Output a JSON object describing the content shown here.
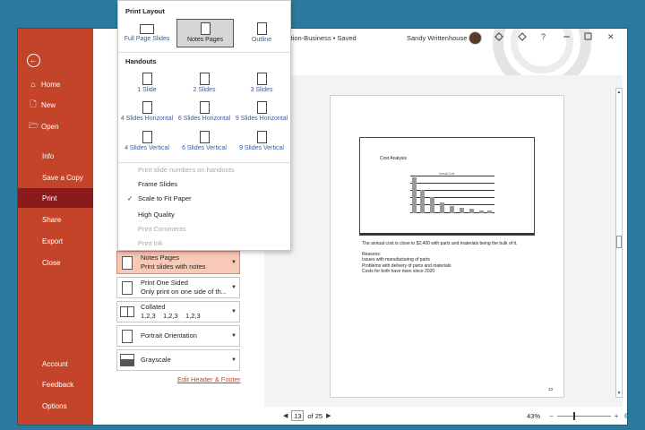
{
  "titlebar": {
    "doc_title": "entation-Business • Saved",
    "user": "Sandy Writtenhouse",
    "icons": [
      "share-icon",
      "diamond-icon",
      "help-icon",
      "minimize-icon",
      "restore-icon",
      "close-icon"
    ],
    "help_glyph": "?",
    "close_glyph": "✕"
  },
  "nav": {
    "back_glyph": "←",
    "items": [
      {
        "label": "Home",
        "icon": "home-icon",
        "glyph": "⌂"
      },
      {
        "label": "New",
        "icon": "new-icon",
        "glyph": "🗋"
      },
      {
        "label": "Open",
        "icon": "open-folder-icon",
        "glyph": "🗁"
      },
      {
        "label": "Info"
      },
      {
        "label": "Save a Copy"
      },
      {
        "label": "Print",
        "active": true
      },
      {
        "label": "Share"
      },
      {
        "label": "Export"
      },
      {
        "label": "Close"
      },
      {
        "label": "Account"
      },
      {
        "label": "Feedback"
      },
      {
        "label": "Options"
      }
    ]
  },
  "dropdown": {
    "print_layout_heading": "Print Layout",
    "layouts": [
      "Full Page Slides",
      "Notes Pages",
      "Outline"
    ],
    "selected_layout": "Notes Pages",
    "handouts_heading": "Handouts",
    "handouts": [
      "1 Slide",
      "2 Slides",
      "3 Slides",
      "4 Slides Horizontal",
      "6 Slides Horizontal",
      "9 Slides Horizontal",
      "4 Slides Vertical",
      "6 Slides Vertical",
      "9 Slides Vertical"
    ],
    "options": [
      {
        "label": "Print slide numbers on handouts",
        "enabled": false
      },
      {
        "label": "Frame Slides",
        "enabled": true
      },
      {
        "label": "Scale to Fit Paper",
        "enabled": true,
        "checked": true
      },
      {
        "label": "High Quality",
        "enabled": true
      },
      {
        "label": "Print Comments",
        "enabled": false
      },
      {
        "label": "Print Ink",
        "enabled": false
      }
    ],
    "check_glyph": "✓"
  },
  "settings": {
    "layout": {
      "title": "Notes Pages",
      "sub": "Print slides with notes"
    },
    "sides": {
      "title": "Print One Sided",
      "sub": "Only print on one side of th..."
    },
    "collation": {
      "title": "Collated",
      "sub": "1,2,3    1,2,3    1,2,3"
    },
    "orientation": {
      "title": "Portrait Orientation"
    },
    "color": {
      "title": "Grayscale"
    },
    "caret": "▼",
    "edit_link": "Edit Header & Footer"
  },
  "preview": {
    "slide_title": "Cost Analysis",
    "chart_title": "Annual Cost",
    "notes": [
      "The annual cost is close to $2,400 with parts and materials being the bulk of it.",
      "",
      "Reasons:",
      "Issues with manufacturing of parts",
      "Problems with delivery of parts and materials",
      "Costs for both have risen since 2020"
    ],
    "page_number": "13"
  },
  "pager": {
    "current": "13",
    "of_text": "of 25",
    "prev_glyph": "◀",
    "next_glyph": "▶"
  },
  "zoom": {
    "level": "43%",
    "minus": "−",
    "plus": "+",
    "fit_glyph": "⊕"
  },
  "scroll": {
    "up": "▲",
    "down": "▼"
  }
}
